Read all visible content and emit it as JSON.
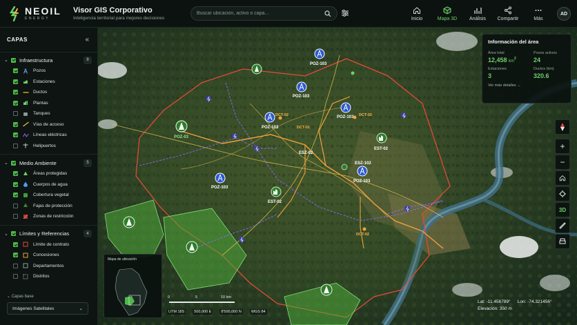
{
  "header": {
    "logo_name": "NEOIL",
    "logo_sub": "ENERGY",
    "app_title": "Visor GIS Corporativo",
    "app_subtitle": "Inteligencia territorial para mejores decisiones",
    "search_placeholder": "Buscar ubicación, activo o capa...",
    "nav": [
      {
        "label": "Inicio",
        "icon": "home-icon"
      },
      {
        "label": "Mapa 3D",
        "icon": "cube-icon",
        "active": true
      },
      {
        "label": "Análisis",
        "icon": "analytics-icon"
      },
      {
        "label": "Compartir",
        "icon": "share-icon"
      },
      {
        "label": "Más",
        "icon": "more-icon"
      }
    ],
    "avatar": "AD"
  },
  "sidebar": {
    "title": "CAPAS",
    "groups": [
      {
        "label": "Infraestructura",
        "count": "8",
        "items": [
          {
            "label": "Pozos",
            "checked": true,
            "icon": "well-icon"
          },
          {
            "label": "Estaciones",
            "checked": true,
            "icon": "station-icon"
          },
          {
            "label": "Ductos",
            "checked": true,
            "icon": "pipeline-icon"
          },
          {
            "label": "Plantas",
            "checked": true,
            "icon": "plant-icon"
          },
          {
            "label": "Tanques",
            "checked": false,
            "icon": "tank-icon"
          },
          {
            "label": "Vías de acceso",
            "checked": true,
            "icon": "road-icon"
          },
          {
            "label": "Líneas eléctricas",
            "checked": true,
            "icon": "power-line-icon"
          },
          {
            "label": "Helipuertos",
            "checked": false,
            "icon": "heliport-icon"
          }
        ]
      },
      {
        "label": "Medio Ambiente",
        "count": "5",
        "items": [
          {
            "label": "Áreas protegidas",
            "checked": true,
            "icon": "protected-area-icon"
          },
          {
            "label": "Cuerpos de agua",
            "checked": true,
            "icon": "water-icon"
          },
          {
            "label": "Cobertura vegetal",
            "checked": true,
            "icon": "vegetation-icon"
          },
          {
            "label": "Fajas de protección",
            "checked": false,
            "icon": "buffer-icon"
          },
          {
            "label": "Zonas de restricción",
            "checked": false,
            "icon": "restriction-icon"
          }
        ]
      },
      {
        "label": "Límites y Referencias",
        "count": "4",
        "items": [
          {
            "label": "Límite de contrato",
            "checked": true,
            "icon": "contract-boundary-icon"
          },
          {
            "label": "Concesiones",
            "checked": true,
            "icon": "concession-icon"
          },
          {
            "label": "Departamentos",
            "checked": false,
            "icon": "department-icon"
          },
          {
            "label": "Distritos",
            "checked": false,
            "icon": "district-icon"
          }
        ]
      }
    ],
    "basemap_label": "Capas base",
    "basemap_value": "Imágenes Satelitales"
  },
  "info": {
    "title": "Información del área",
    "area_label": "Área total",
    "area_value": "12,458",
    "area_unit": "km",
    "area_unit_sup": "2",
    "wells_label": "Pozos activos",
    "wells_value": "24",
    "stations_label": "Estaciones",
    "stations_value": "3",
    "ducts_label": "Ductos (km)",
    "ducts_value": "320.6",
    "link": "Ver más detalles →"
  },
  "controls": {
    "compass": "N",
    "zoom_in": "+",
    "zoom_out": "−",
    "mode": "3D"
  },
  "locator": {
    "title": "Mapa de ubicación"
  },
  "scale": {
    "zero": "0",
    "mid": "5",
    "end": "10 km"
  },
  "projection": {
    "zone": "UTM 18S",
    "easting": "500,000 E",
    "northing": "8'500,000 N",
    "datum": "WGS 84"
  },
  "readout": {
    "lat": "Lat: -11.456789°",
    "lon": "Lon: -74.321456°",
    "elev": "Elevación: 350 m"
  },
  "map_labels": {
    "wells": [
      "POZ-103",
      "POZ-103",
      "POZ-103",
      "POZ-103",
      "POZ-103",
      "POZ-103",
      "POZ-103"
    ],
    "plants": [
      "POZ-03",
      "EST-02",
      "EST-02"
    ],
    "stations": [
      "EST-02",
      "ESZ-102",
      "ESZ-02"
    ],
    "ducts": [
      "DCT-02",
      "DCT-02",
      "DCT-01",
      "DCT-02"
    ]
  },
  "colors": {
    "accent": "#6fd06a",
    "boundary": "#e24a3b",
    "pipeline": "#f2a23a",
    "power": "#8a6bff"
  }
}
